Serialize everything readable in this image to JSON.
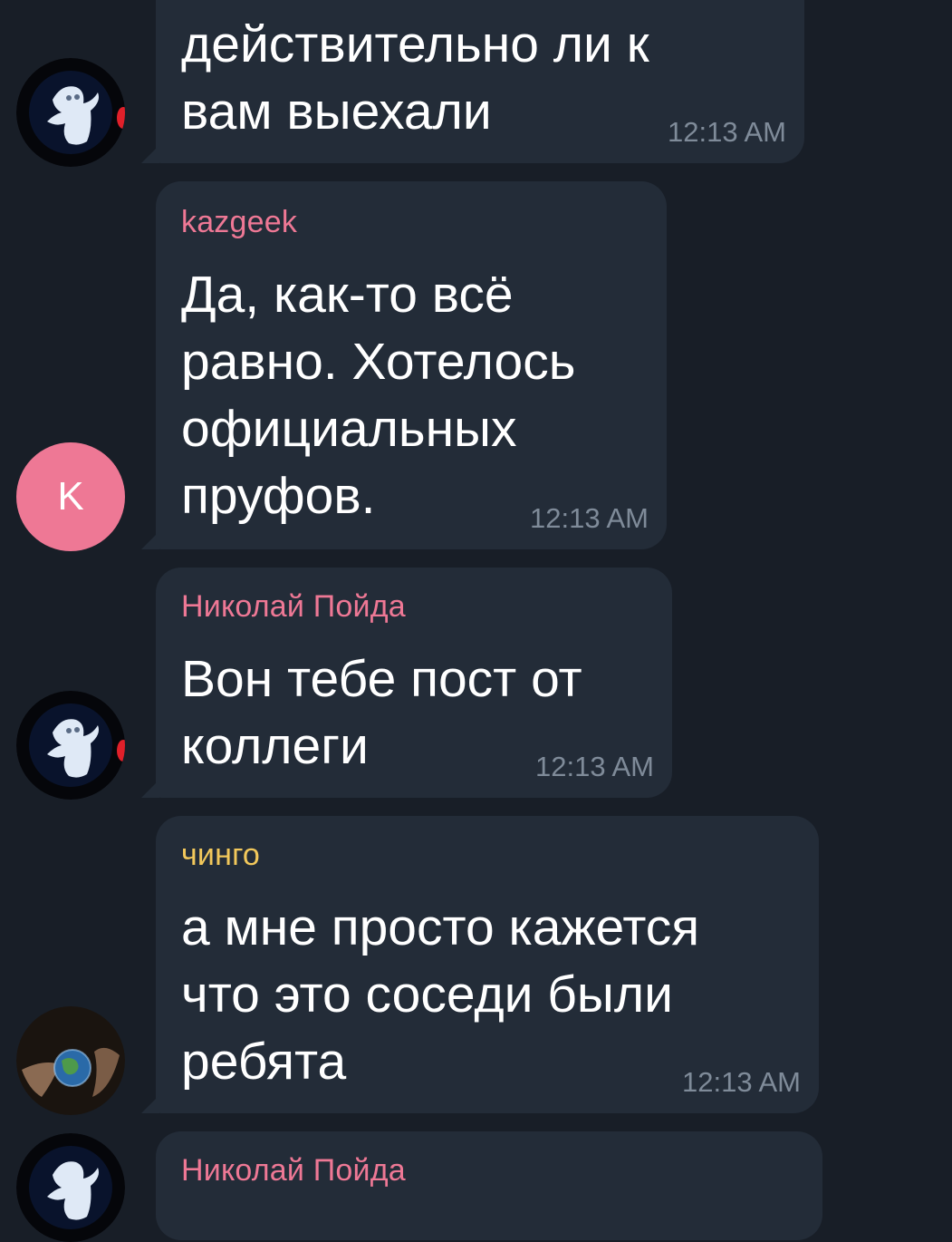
{
  "colors": {
    "background": "#181e27",
    "bubble": "#232c38",
    "text": "#ffffff",
    "time": "#7f8b99",
    "sender_pink": "#ee7895",
    "sender_yellow": "#f2c85b",
    "avatar_k": "#ee7895"
  },
  "messages": [
    {
      "sender": "",
      "lines": [
        "действительно ли к",
        "вам выехали"
      ],
      "time": "12:13 AM",
      "avatar": "ghost-icon"
    },
    {
      "sender": "kazgeek",
      "lines": [
        "Да, как-то всё",
        "равно. Хотелось",
        "официальных",
        "пруфов."
      ],
      "time": "12:13 AM",
      "avatar_letter": "K"
    },
    {
      "sender": "Николай Пойда",
      "lines": [
        "Вон тебе пост от",
        "коллеги"
      ],
      "time": "12:13 AM",
      "avatar": "ghost-icon"
    },
    {
      "sender": "чинго",
      "lines": [
        "а мне просто кажется",
        "что это соседи были",
        "ребята"
      ],
      "time": "12:13 AM",
      "avatar": "globe-in-hands-icon"
    },
    {
      "sender": "Николай Пойда",
      "avatar": "ghost-icon"
    }
  ]
}
